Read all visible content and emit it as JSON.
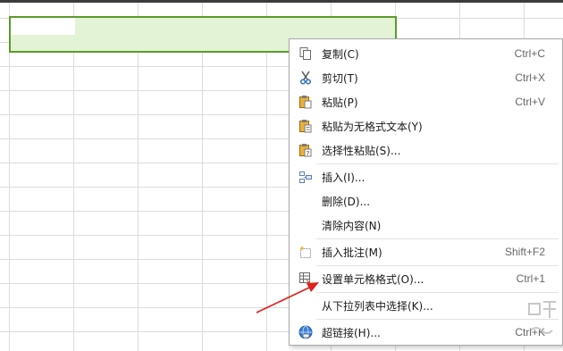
{
  "context_menu": {
    "items": [
      {
        "label": "复制(C)",
        "shortcut": "Ctrl+C",
        "icon": "copy-icon"
      },
      {
        "label": "剪切(T)",
        "shortcut": "Ctrl+X",
        "icon": "scissors-icon"
      },
      {
        "label": "粘贴(P)",
        "shortcut": "Ctrl+V",
        "icon": "paste-icon"
      },
      {
        "label": "粘贴为无格式文本(Y)",
        "shortcut": "",
        "icon": "paste-plain-text-icon"
      },
      {
        "label": "选择性粘贴(S)...",
        "shortcut": "",
        "icon": "paste-special-icon"
      },
      {
        "label": "插入(I)...",
        "shortcut": "",
        "icon": "insert-icon"
      },
      {
        "label": "删除(D)...",
        "shortcut": "",
        "icon": ""
      },
      {
        "label": "清除内容(N)",
        "shortcut": "",
        "icon": ""
      },
      {
        "label": "插入批注(M)",
        "shortcut": "Shift+F2",
        "icon": "insert-comment-icon"
      },
      {
        "label": "设置单元格格式(O)...",
        "shortcut": "Ctrl+1",
        "icon": "format-cells-icon"
      },
      {
        "label": "从下拉列表中选择(K)...",
        "shortcut": "",
        "icon": ""
      },
      {
        "label": "超链接(H)...",
        "shortcut": "Ctrl+K",
        "icon": "hyperlink-icon"
      }
    ]
  },
  "colors": {
    "selection_border": "#5c9a2a",
    "selection_fill": "#e3f3d6",
    "annotation_arrow": "#e0201c"
  }
}
